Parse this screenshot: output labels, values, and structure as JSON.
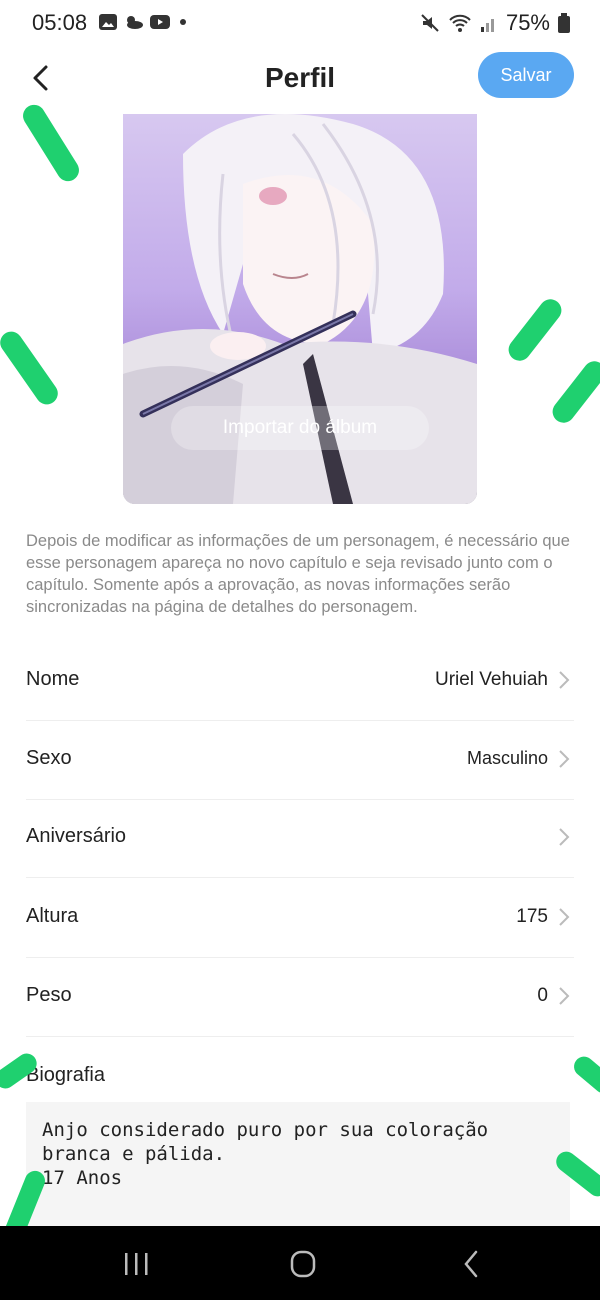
{
  "status": {
    "time": "05:08",
    "battery": "75%"
  },
  "header": {
    "title": "Perfil",
    "save_label": "Salvar"
  },
  "avatar": {
    "import_label": "Importar do álbum"
  },
  "notice": "Depois de modificar as informações de um personagem, é necessário que esse personagem apareça no novo capítulo e seja revisado junto com o capítulo. Somente após a aprovação, as novas informações serão sincronizadas na página de detalhes do personagem.",
  "fields": [
    {
      "label": "Nome",
      "value": "Uriel Vehuiah"
    },
    {
      "label": "Sexo",
      "value": "Masculino"
    },
    {
      "label": "Aniversário",
      "value": ""
    },
    {
      "label": "Altura",
      "value": "175"
    },
    {
      "label": "Peso",
      "value": "0"
    }
  ],
  "bio": {
    "label": "Biografia",
    "text": "Anjo considerado puro por sua coloração\nbranca e pálida.\n17 Anos"
  },
  "colors": {
    "accent": "#5aa8f2",
    "decor_green": "#1fd06f"
  },
  "icons": [
    "back-arrow-icon",
    "chevron-right-icon",
    "recent-apps-icon",
    "home-icon",
    "nav-back-icon"
  ]
}
